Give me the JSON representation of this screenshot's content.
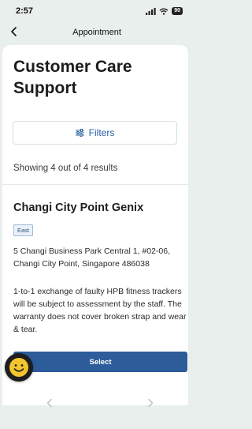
{
  "status_bar": {
    "time": "2:57",
    "battery": "90"
  },
  "header": {
    "title": "Appointment"
  },
  "main": {
    "page_title": "Customer Care Support",
    "filters_label": "Filters",
    "results_text": "Showing 4 out of 4 results",
    "location": {
      "name": "Changi City Point Genix",
      "region": "East",
      "address": "5 Changi Business Park Central 1, #02-06, Changi City Point, Singapore 486038",
      "terms": "1-to-1 exchange of faulty HPB fitness trackers will be subject to assessment by the staff. The warranty does not cover broken strap and wear & tear.",
      "select_label": "Select"
    }
  },
  "colors": {
    "background": "#e9efec",
    "accent": "#2c5c9a",
    "link": "#2a5fa3",
    "chat_bubble": "#f3c52d"
  }
}
